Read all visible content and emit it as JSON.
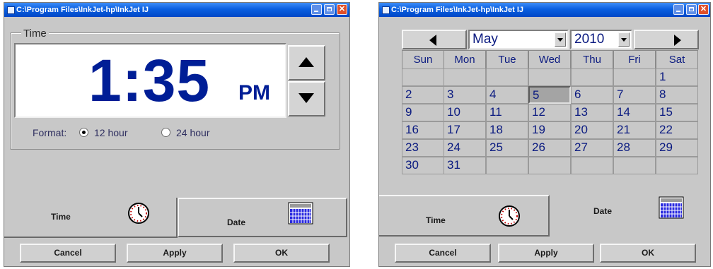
{
  "window_title": "C:\\Program Files\\InkJet-hp\\InkJet   IJ",
  "time_window": {
    "group_label": "Time",
    "time_value": "1:35",
    "ampm": "PM",
    "format_label": "Format:",
    "option_12": "12 hour",
    "option_24": "24 hour",
    "selected_format": "12 hour"
  },
  "date_window": {
    "month": "May",
    "year": "2010",
    "weekdays": [
      "Sun",
      "Mon",
      "Tue",
      "Wed",
      "Thu",
      "Fri",
      "Sat"
    ],
    "weeks": [
      [
        "",
        "",
        "",
        "",
        "",
        "",
        "1"
      ],
      [
        "2",
        "3",
        "4",
        "5",
        "6",
        "7",
        "8"
      ],
      [
        "9",
        "10",
        "11",
        "12",
        "13",
        "14",
        "15"
      ],
      [
        "16",
        "17",
        "18",
        "19",
        "20",
        "21",
        "22"
      ],
      [
        "23",
        "24",
        "25",
        "26",
        "27",
        "28",
        "29"
      ],
      [
        "30",
        "31",
        "",
        "",
        "",
        "",
        ""
      ]
    ],
    "selected_day": "5"
  },
  "tabs": {
    "time": "Time",
    "date": "Date"
  },
  "buttons": {
    "cancel": "Cancel",
    "apply": "Apply",
    "ok": "OK"
  },
  "colors": {
    "titlebar": "#0a5fe0",
    "accent_text": "#001e96",
    "panel": "#c8c8c8"
  }
}
